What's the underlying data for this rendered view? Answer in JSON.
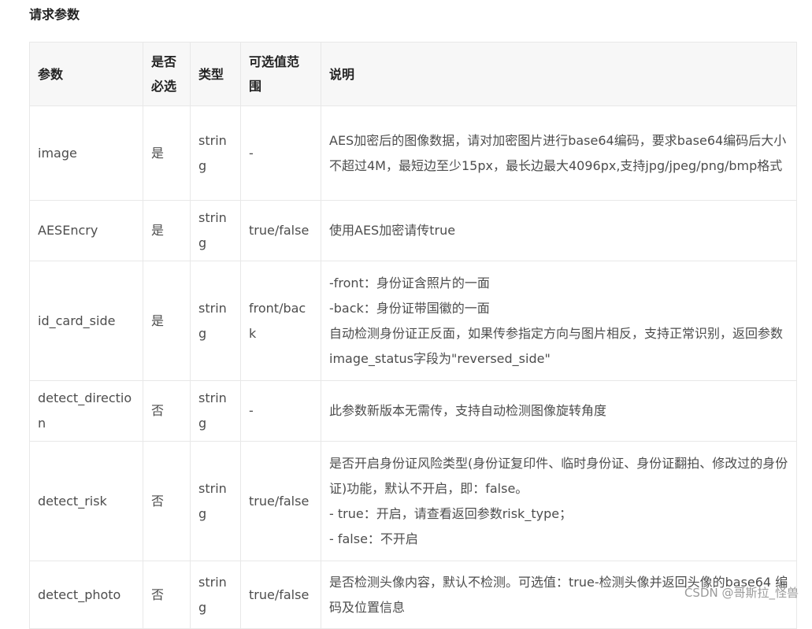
{
  "section": {
    "title": "请求参数"
  },
  "table": {
    "headers": [
      "参数",
      "是否\n必选",
      "类型",
      "可选值范\n围",
      "说明"
    ],
    "rows": [
      {
        "param": "image",
        "required": "是",
        "type": "string",
        "options": "-",
        "desc": [
          "AES加密后的图像数据，请对加密图片进行base64编码，要求base64编码后大小不超过4M，最短边至少15px，最长边最大4096px,支持jpg/jpeg/png/bmp格式"
        ]
      },
      {
        "param": "AESEncry",
        "required": "是",
        "type": "string",
        "options": "true/false",
        "desc": [
          "使用AES加密请传true"
        ]
      },
      {
        "param": "id_card_side",
        "required": "是",
        "type": "string",
        "options": "front/back",
        "desc": [
          "-front：身份证含照片的一面",
          "-back：身份证带国徽的一面",
          "自动检测身份证正反面，如果传参指定方向与图片相反，支持正常识别，返回参数image_status字段为\"reversed_side\""
        ]
      },
      {
        "param": "detect_direction",
        "required": "否",
        "type": "string",
        "options": "-",
        "desc": [
          "此参数新版本无需传，支持自动检测图像旋转角度"
        ]
      },
      {
        "param": "detect_risk",
        "required": "否",
        "type": "string",
        "options": "true/false",
        "desc": [
          "是否开启身份证风险类型(身份证复印件、临时身份证、身份证翻拍、修改过的身份证)功能，默认不开启，即：false。",
          "- true：开启，请查看返回参数risk_type；",
          "- false：不开启"
        ]
      },
      {
        "param": "detect_photo",
        "required": "否",
        "type": "string",
        "options": "true/false",
        "desc": [
          "是否检测头像内容，默认不检测。可选值：true-检测头像并返回头像的base64 编码及位置信息"
        ]
      }
    ]
  },
  "watermark": {
    "text": "CSDN @哥斯拉_怪兽"
  }
}
